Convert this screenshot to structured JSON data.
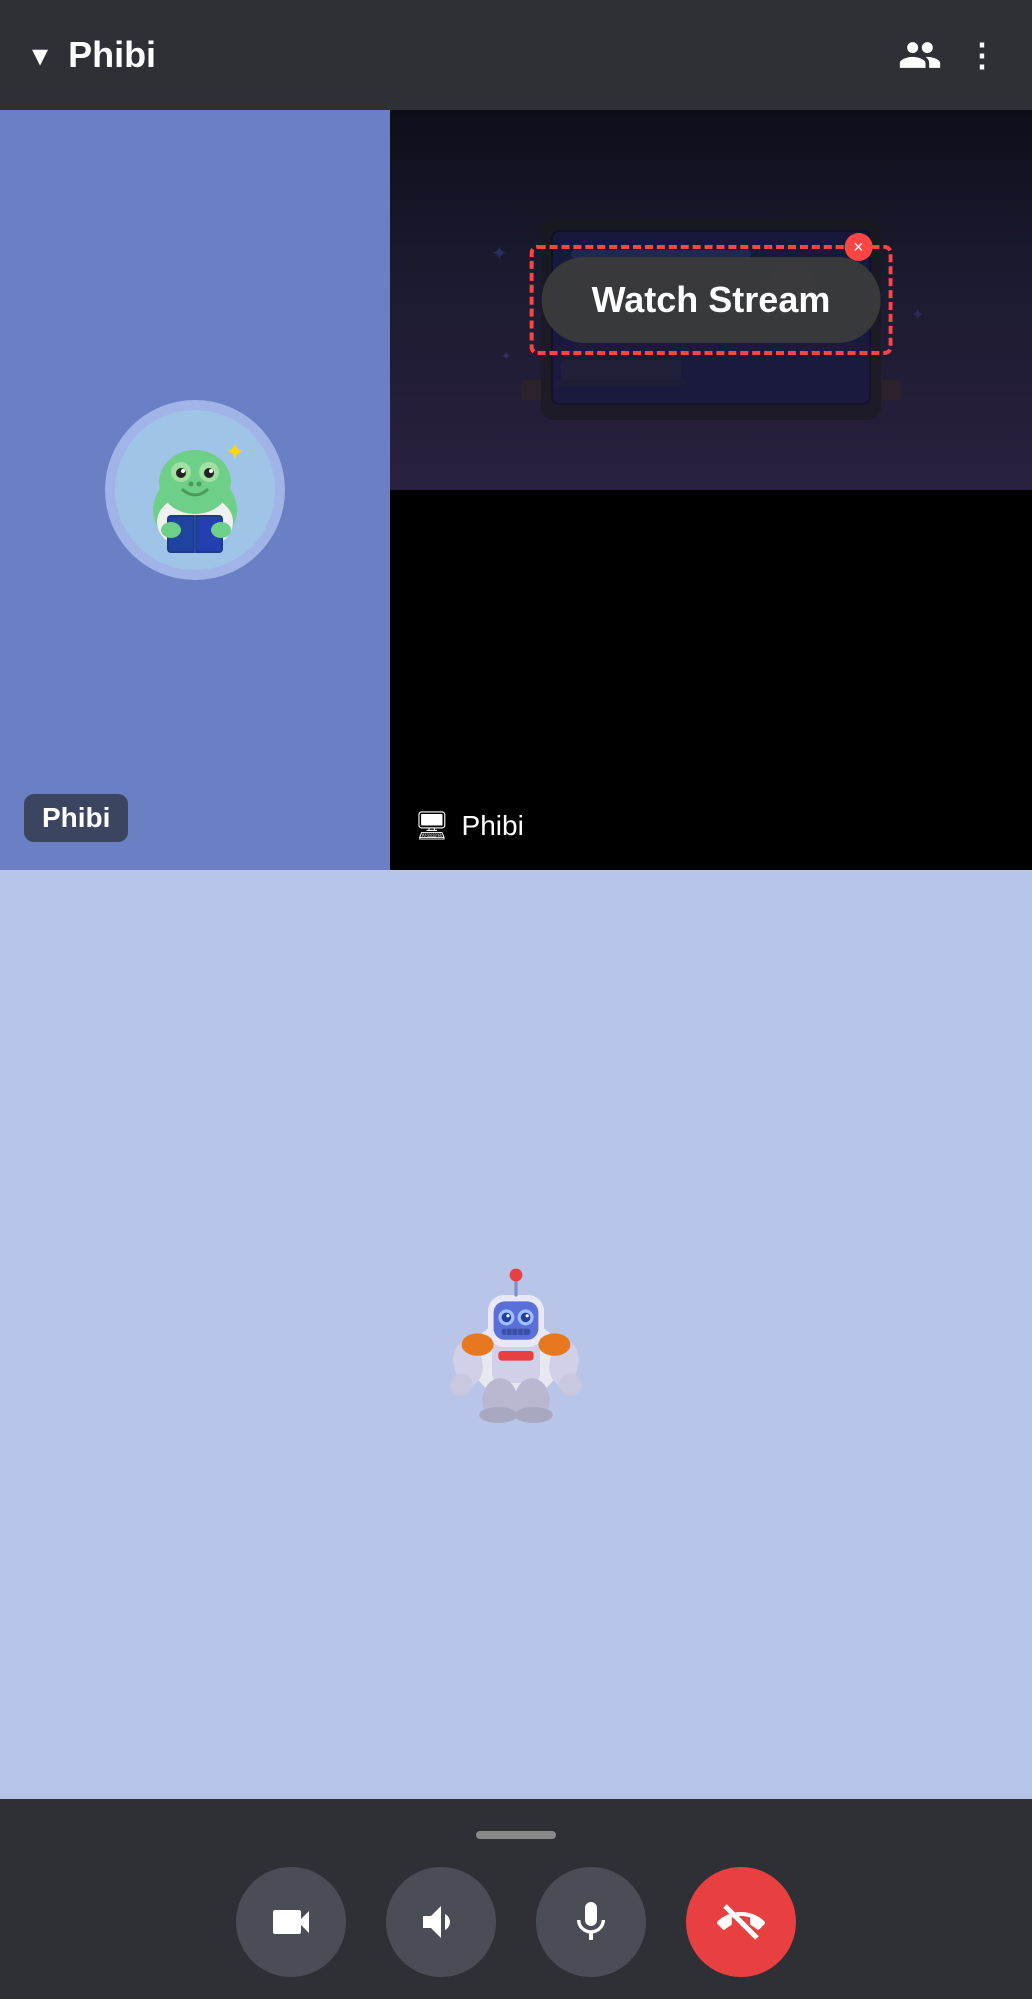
{
  "header": {
    "title": "Phibi",
    "chevron_label": "▾",
    "more_label": "⋮"
  },
  "left_panel": {
    "name_badge": "Phibi"
  },
  "right_panel": {
    "watch_stream_label": "Watch Stream",
    "close_label": "×",
    "name_badge": "Phibi"
  },
  "controls": {
    "camera_label": "camera",
    "speaker_label": "speaker",
    "mic_label": "microphone",
    "end_call_label": "end call"
  },
  "colors": {
    "accent_red": "#e84040",
    "panel_bg": "#6b7fc4",
    "self_bg": "#b8c4e8",
    "header_bg": "#2e3035",
    "bottom_bg": "#2e3035",
    "screen_bg": "#000000"
  }
}
